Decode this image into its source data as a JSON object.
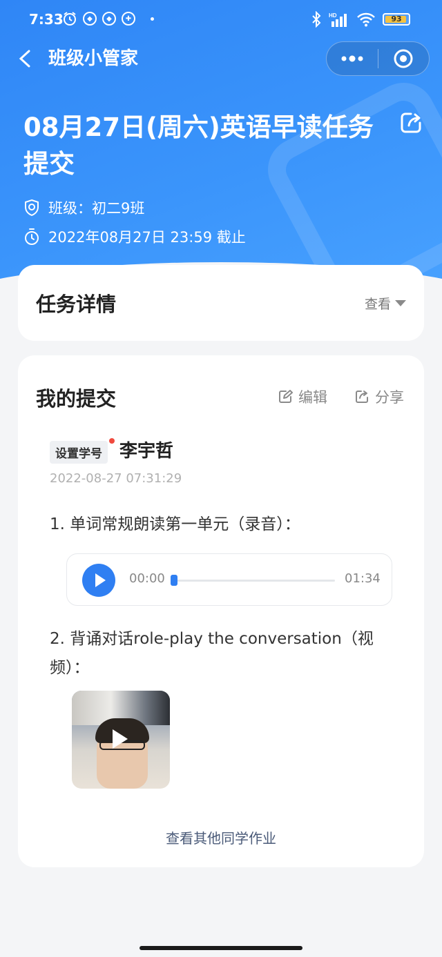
{
  "status_bar": {
    "time": "7:33",
    "battery_level": "93",
    "battery_fraction": 0.93,
    "icons": [
      "alarm-icon",
      "app-notif-icon",
      "app-notif-icon",
      "app-notif-icon",
      "bluetooth-icon",
      "signal-icon",
      "wifi-icon",
      "battery-icon"
    ]
  },
  "nav": {
    "title": "班级小管家"
  },
  "task": {
    "title": "08月27日(周六)英语早读任务提交",
    "class_label": "班级：初二9班",
    "deadline": "2022年08月27日 23:59 截止"
  },
  "details_card": {
    "title": "任务详情",
    "toggle_label": "查看"
  },
  "submission_card": {
    "title": "我的提交",
    "edit_label": "编辑",
    "share_label": "分享",
    "set_id_badge": "设置学号",
    "student_name": "李宇哲",
    "submit_time": "2022-08-27 07:31:29",
    "question1": "1. 单词常规朗读第一单元（录音）：",
    "audio": {
      "current": "00:00",
      "total": "01:34",
      "progress": 0.0
    },
    "question2": "2. 背诵对话role-play the conversation（视频）：",
    "view_others": "查看其他同学作业"
  },
  "colors": {
    "brand_blue": "#2f86f6",
    "accent_blue": "#2f7ff2",
    "badge_red": "#f04a3e"
  }
}
